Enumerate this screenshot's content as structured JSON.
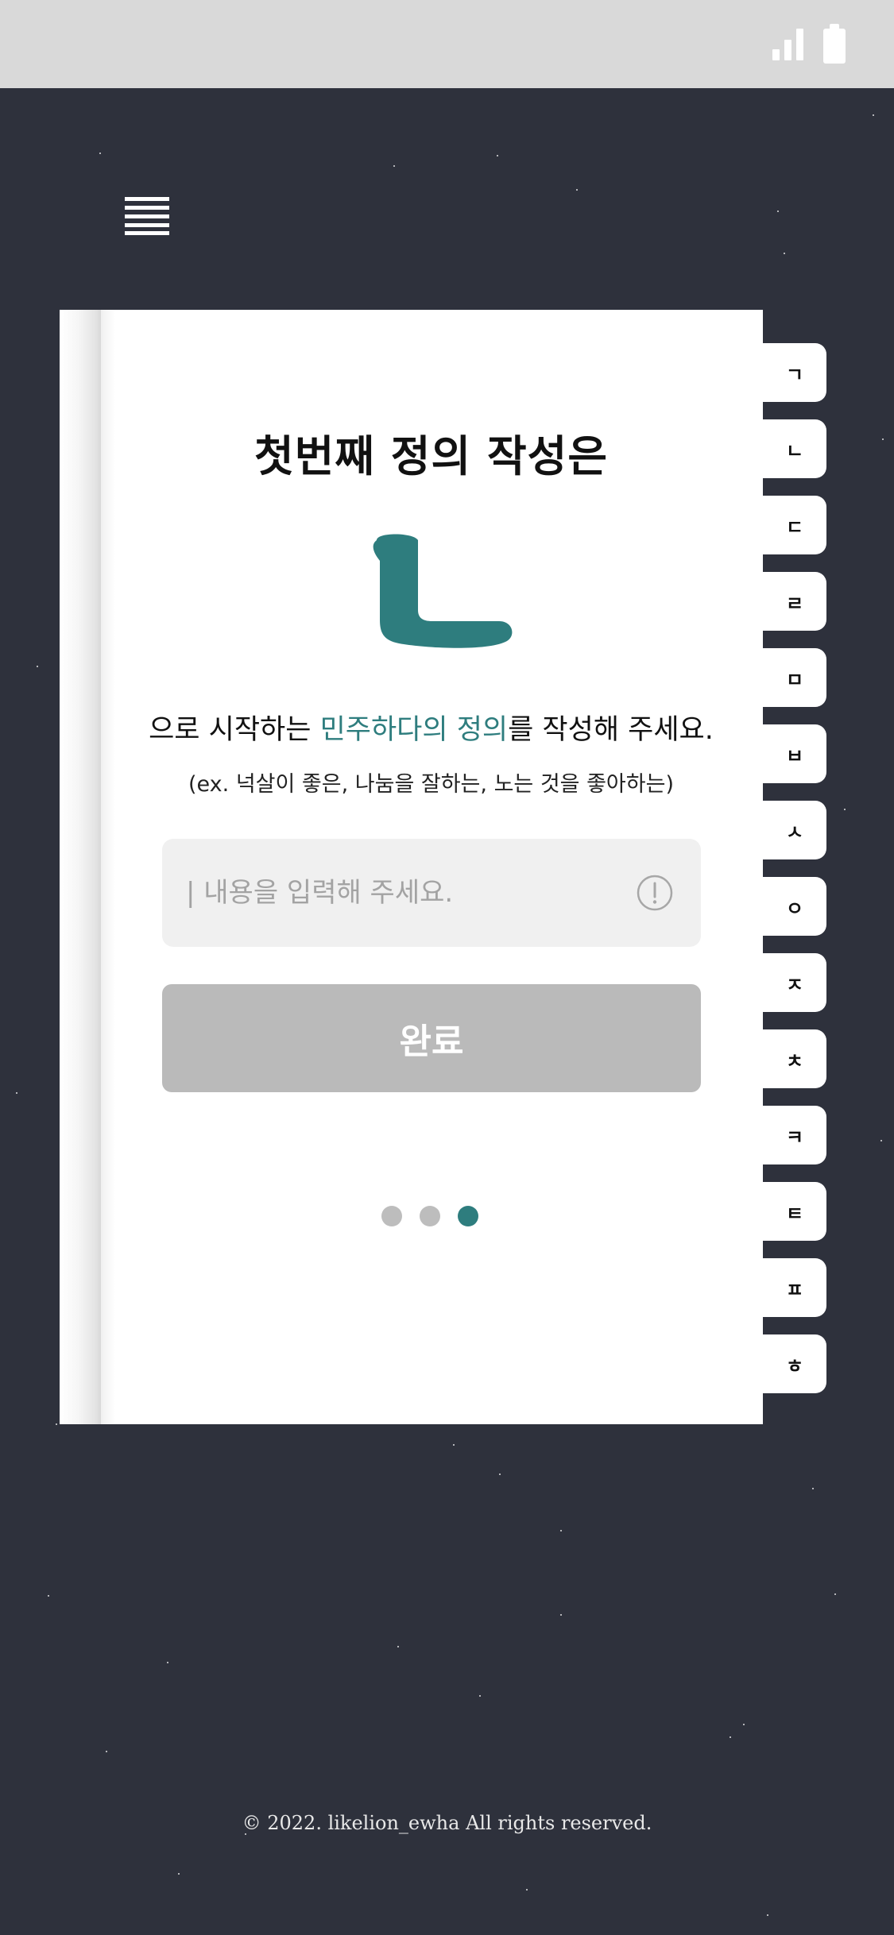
{
  "status_bar": {
    "signal_icon": "signal-bars-icon",
    "battery_icon": "battery-icon"
  },
  "menu": {
    "icon": "hamburger-menu-icon"
  },
  "card": {
    "title": "첫번째 정의 작성은",
    "consonant": "ㄴ",
    "instruction_prefix": "으로 시작하는 ",
    "instruction_highlight": "민주하다의 정의",
    "instruction_suffix": "를 작성해 주세요.",
    "example": "(ex. 넉살이 좋은, 나눔을 잘하는, 노는 것을 좋아하는)",
    "input": {
      "placeholder": "| 내용을 입력해 주세요.",
      "value": "",
      "icon": "exclamation-circle-icon"
    },
    "submit_label": "완료",
    "pagination": {
      "total": 3,
      "active": 3
    }
  },
  "index_tabs": [
    "ㄱ",
    "ㄴ",
    "ㄷ",
    "ㄹ",
    "ㅁ",
    "ㅂ",
    "ㅅ",
    "ㅇ",
    "ㅈ",
    "ㅊ",
    "ㅋ",
    "ㅌ",
    "ㅍ",
    "ㅎ"
  ],
  "footer": "© 2022. likelion_ewha All rights reserved.",
  "colors": {
    "background": "#2e313c",
    "accent": "#2e7d7e",
    "button_disabled": "#bababa",
    "status_bar": "#d9d9d9"
  }
}
